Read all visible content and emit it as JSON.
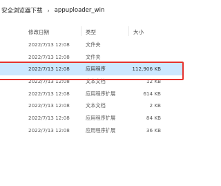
{
  "breadcrumb": {
    "parent": "安全浏览器下载",
    "separator": "›",
    "current": "appuploader_win"
  },
  "columns": {
    "date": "修改日期",
    "type": "类型",
    "size": "大小"
  },
  "rows": [
    {
      "date": "2022/7/13 12:08",
      "type": "文件夹",
      "size": ""
    },
    {
      "date": "2022/7/13 12:08",
      "type": "文件夹",
      "size": ""
    },
    {
      "date": "2022/7/13 12:08",
      "type": "应用程序",
      "size": "112,906 KB",
      "selected": true
    },
    {
      "date": "2022/7/13 12:08",
      "type": "文本文档",
      "size": "12 KB"
    },
    {
      "date": "2022/7/13 12:08",
      "type": "应用程序扩展",
      "size": "614 KB"
    },
    {
      "date": "2022/7/13 12:08",
      "type": "文本文档",
      "size": "2 KB"
    },
    {
      "date": "2022/7/13 12:08",
      "type": "应用程序扩展",
      "size": "84 KB"
    },
    {
      "date": "2022/7/13 12:08",
      "type": "应用程序扩展",
      "size": "36 KB"
    }
  ],
  "colors": {
    "selection": "#cce8ff",
    "highlight": "#e5322d"
  }
}
